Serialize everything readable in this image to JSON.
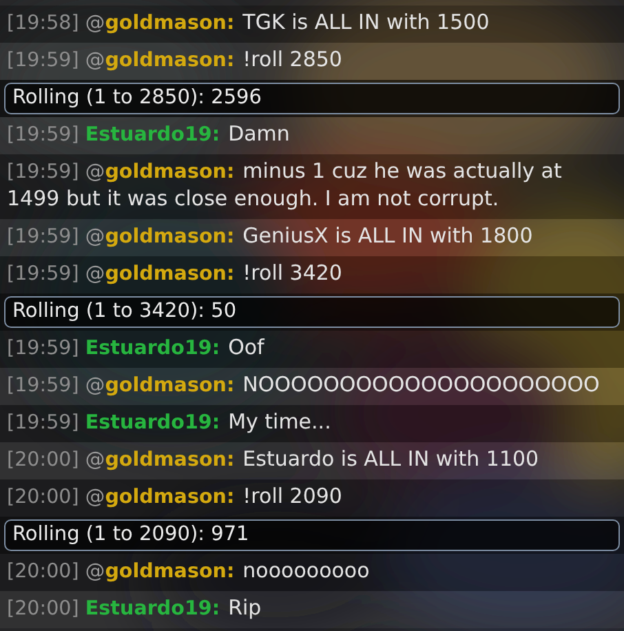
{
  "messages": [
    {
      "kind": "chat",
      "time": "[19:58]",
      "prefix": "@",
      "user": "goldmason:",
      "color": "#d4a90f",
      "text": "TGK is ALL IN with 1500"
    },
    {
      "kind": "chat",
      "time": "[19:59]",
      "prefix": "@",
      "user": "goldmason:",
      "color": "#d4a90f",
      "text": "!roll 2850"
    },
    {
      "kind": "roll",
      "text": "Rolling (1 to 2850): 2596"
    },
    {
      "kind": "chat",
      "time": "[19:59]",
      "user": "Estuardo19:",
      "color": "#27b53f",
      "text": "Damn"
    },
    {
      "kind": "chat",
      "time": "[19:59]",
      "prefix": "@",
      "user": "goldmason:",
      "color": "#d4a90f",
      "text": "minus 1 cuz he was actually at 1499 but it was close enough. I am not corrupt."
    },
    {
      "kind": "chat",
      "time": "[19:59]",
      "prefix": "@",
      "user": "goldmason:",
      "color": "#d4a90f",
      "text": "GeniusX is ALL IN with 1800"
    },
    {
      "kind": "chat",
      "time": "[19:59]",
      "prefix": "@",
      "user": "goldmason:",
      "color": "#d4a90f",
      "text": "!roll 3420"
    },
    {
      "kind": "roll",
      "text": "Rolling (1 to 3420): 50"
    },
    {
      "kind": "chat",
      "time": "[19:59]",
      "user": "Estuardo19:",
      "color": "#27b53f",
      "text": "Oof"
    },
    {
      "kind": "chat",
      "time": "[19:59]",
      "prefix": "@",
      "user": "goldmason:",
      "color": "#d4a90f",
      "text": "NOOOOOOOOOOOOOOOOOOOOO"
    },
    {
      "kind": "chat",
      "time": "[19:59]",
      "user": "Estuardo19:",
      "color": "#27b53f",
      "text": "My time..."
    },
    {
      "kind": "chat",
      "time": "[20:00]",
      "prefix": "@",
      "user": "goldmason:",
      "color": "#d4a90f",
      "text": "Estuardo is ALL IN with 1100"
    },
    {
      "kind": "chat",
      "time": "[20:00]",
      "prefix": "@",
      "user": "goldmason:",
      "color": "#d4a90f",
      "text": "!roll 2090"
    },
    {
      "kind": "roll",
      "text": "Rolling (1 to 2090): 971"
    },
    {
      "kind": "chat",
      "time": "[20:00]",
      "prefix": "@",
      "user": "goldmason:",
      "color": "#d4a90f",
      "text": "nooooooooo"
    },
    {
      "kind": "chat",
      "time": "[20:00]",
      "user": "Estuardo19:",
      "color": "#27b53f",
      "text": "Rip"
    }
  ]
}
